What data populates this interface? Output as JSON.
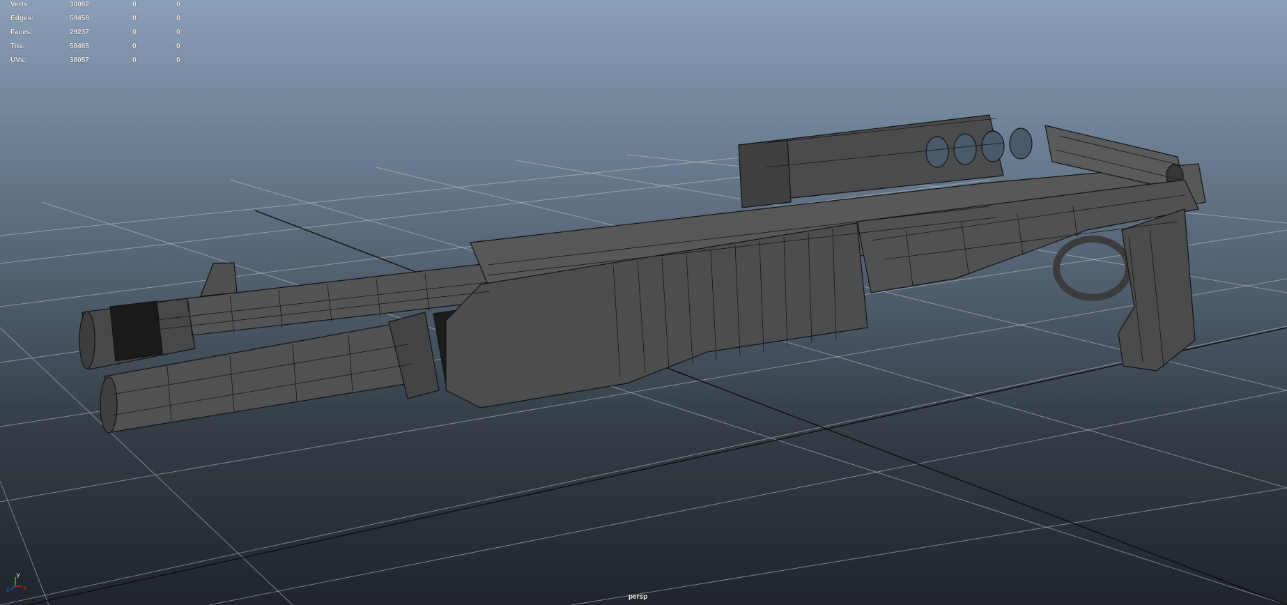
{
  "heads_up": {
    "rows": [
      {
        "label": "Verts:",
        "total": "30062",
        "selected": "0",
        "selected2": "0"
      },
      {
        "label": "Edges:",
        "total": "59458",
        "selected": "0",
        "selected2": "0"
      },
      {
        "label": "Faces:",
        "total": "29237",
        "selected": "0",
        "selected2": "0"
      },
      {
        "label": "Tris:",
        "total": "58465",
        "selected": "0",
        "selected2": "0"
      },
      {
        "label": "UVs:",
        "total": "38057",
        "selected": "0",
        "selected2": "0"
      }
    ]
  },
  "viewport": {
    "camera_label": "persp",
    "model_icon": "shotgun-wireframe-model",
    "gizmo_icon": "xyz-axis-icon",
    "axis_letters": {
      "x": "x",
      "y": "y",
      "z": "z"
    }
  },
  "colors": {
    "background_top": "#8a9fb8",
    "background_bottom": "#1f252b",
    "grid": "#c6cdd4",
    "model_fill": "#4e4f51",
    "wire": "#111111",
    "axis_x": "#d62020",
    "axis_y": "#2fc02f",
    "axis_z": "#2a4fd8"
  }
}
